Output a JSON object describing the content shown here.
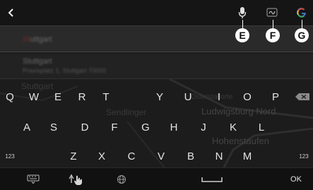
{
  "top_bar": {
    "back_icon": "chevron-left-icon",
    "voice_icon": "microphone-icon",
    "handwriting_icon": "handwriting-icon",
    "google_icon": "google-g-icon"
  },
  "callouts": {
    "e": "E",
    "f": "F",
    "g": "G"
  },
  "input": {
    "value_highlight": "St",
    "value_rest": "uttgart"
  },
  "suggestion": {
    "title": "Stuttgart",
    "subtitle": "Praxisplatz 1, Stuttgart 70000"
  },
  "map_labels": [
    "Stuttgart",
    "Sendlinger",
    "Osterstallorte",
    "Ludwigsburg Nord",
    "Hohenstaufen"
  ],
  "keyboard": {
    "row1": [
      "Q",
      "W",
      "E",
      "R",
      "T",
      "Y",
      "U",
      "I",
      "O",
      "P"
    ],
    "row2": [
      "A",
      "S",
      "D",
      "F",
      "G",
      "H",
      "J",
      "K",
      "L"
    ],
    "row3": [
      "Z",
      "X",
      "C",
      "V",
      "B",
      "N",
      "M"
    ],
    "numbers_left": "123",
    "numbers_right": "123",
    "ok": "OK"
  },
  "colors": {
    "background": "#1c1c1c",
    "badge": "#ffffff",
    "highlight": "#7a2a2a"
  }
}
